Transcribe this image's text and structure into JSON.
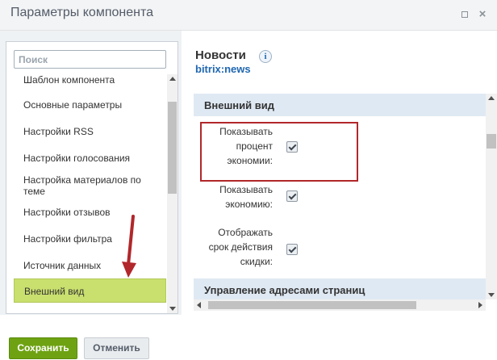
{
  "window": {
    "title": "Параметры компонента",
    "maximize_icon": "maximize-icon",
    "close_icon": "close-icon",
    "close_glyph": "×"
  },
  "sidebar": {
    "search_placeholder": "Поиск",
    "items": [
      {
        "label": "Шаблон компонента"
      },
      {
        "label": "Основные параметры"
      },
      {
        "label": "Настройки RSS"
      },
      {
        "label": "Настройки голосования"
      },
      {
        "label": "Настройка материалов по теме"
      },
      {
        "label": "Настройки отзывов"
      },
      {
        "label": "Настройки фильтра"
      },
      {
        "label": "Источник данных"
      },
      {
        "label": "Внешний вид"
      }
    ],
    "active_item": "Внешний вид"
  },
  "component": {
    "title": "Новости",
    "info_icon": "info-icon",
    "info_glyph": "i",
    "code": "bitrix:news"
  },
  "sections": [
    {
      "title": "Внешний вид",
      "properties": [
        {
          "label_lines": [
            "Показывать",
            "процент",
            "экономии:"
          ],
          "checked": true
        },
        {
          "label_lines": [
            "Показывать",
            "экономию:"
          ],
          "checked": true
        },
        {
          "label_lines": [
            "Отображать",
            "срок действия",
            "скидки:"
          ],
          "checked": true
        }
      ]
    },
    {
      "title": "Управление адресами страниц"
    }
  ],
  "footer": {
    "save_label": "Сохранить",
    "cancel_label": "Отменить"
  },
  "colors": {
    "save_button": "#6ea212",
    "active_item": "#c9df6e",
    "annotation_red": "#b1272b",
    "link_blue": "#2067b0"
  }
}
